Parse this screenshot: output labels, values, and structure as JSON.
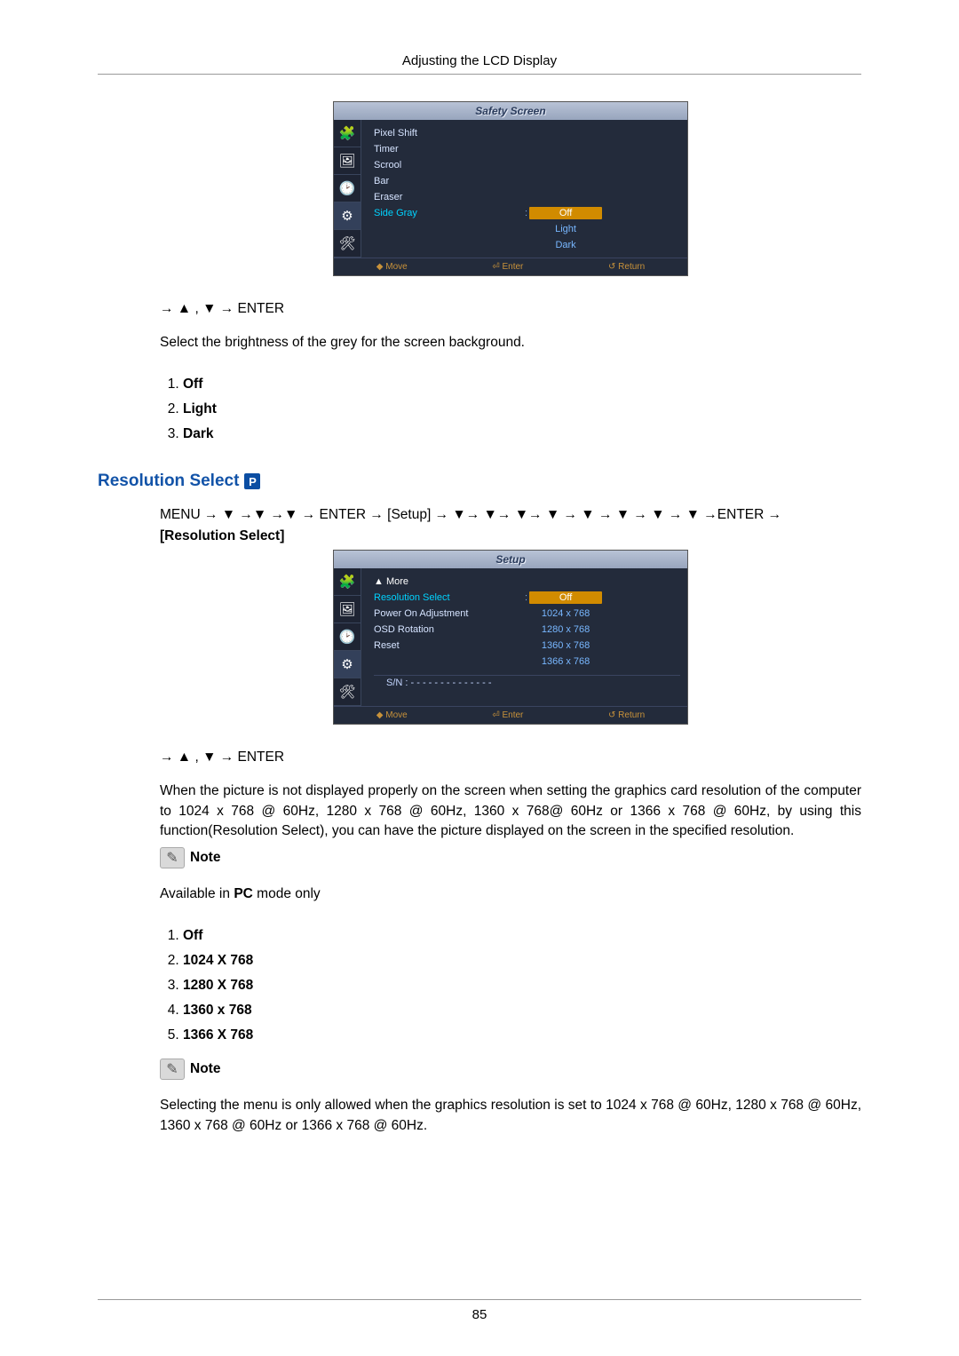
{
  "header_title": "Adjusting the LCD Display",
  "osd1": {
    "title": "Safety Screen",
    "items": [
      "Pixel Shift",
      "Timer",
      "Scrool",
      "Bar",
      "Eraser",
      "Side Gray"
    ],
    "values": [
      "Off",
      "Light",
      "Dark"
    ],
    "footer": [
      "◆ Move",
      "⏎ Enter",
      "↺ Return"
    ]
  },
  "nav_line_1": "→ ▲ , ▼ → ENTER",
  "para1": "Select the brightness of the grey for the screen background.",
  "list1": [
    "Off",
    "Light",
    "Dark"
  ],
  "section_heading": "Resolution Select",
  "menu_path_html_prefix": "MENU → ▼ →▼ →▼ → ENTER → ",
  "menu_path_setup": "[Setup]",
  "menu_path_html_suffix": " → ▼→ ▼→ ▼→ ▼ → ▼ → ▼ → ▼ → ▼ →ENTER →",
  "resolution_select_bold": "[Resolution Select]",
  "osd2": {
    "title": "Setup",
    "items": [
      "▲ More",
      "Resolution Select",
      "Power On Adjustment",
      "OSD Rotation",
      "Reset"
    ],
    "values": [
      "Off",
      "1024 x 768",
      "1280 x 768",
      "1360 x 768",
      "1366 x 768"
    ],
    "sn": "S/N : - - - - - - - - - - - - - -",
    "footer": [
      "◆ Move",
      "⏎ Enter",
      "↺ Return"
    ]
  },
  "nav_line_2": "→ ▲ , ▼ → ENTER",
  "para2": "When the picture is not displayed properly on the screen when setting the graphics card resolution of the computer to 1024 x 768 @ 60Hz, 1280 x 768 @ 60Hz, 1360 x 768@ 60Hz or 1366 x 768 @ 60Hz, by using this function(Resolution Select), you can have the picture displayed on the screen in the specified resolution.",
  "note_label": "Note",
  "para3_pre": "Available in ",
  "para3_bold": "PC",
  "para3_post": " mode only",
  "list2": [
    "Off",
    "1024 X 768",
    "1280 X 768",
    "1360 x 768",
    "1366 X 768"
  ],
  "para4": "Selecting the menu is only allowed when the graphics resolution is set to 1024 x 768 @ 60Hz, 1280 x 768 @ 60Hz, 1360 x 768 @ 60Hz or 1366 x 768 @ 60Hz.",
  "page_number": "85"
}
